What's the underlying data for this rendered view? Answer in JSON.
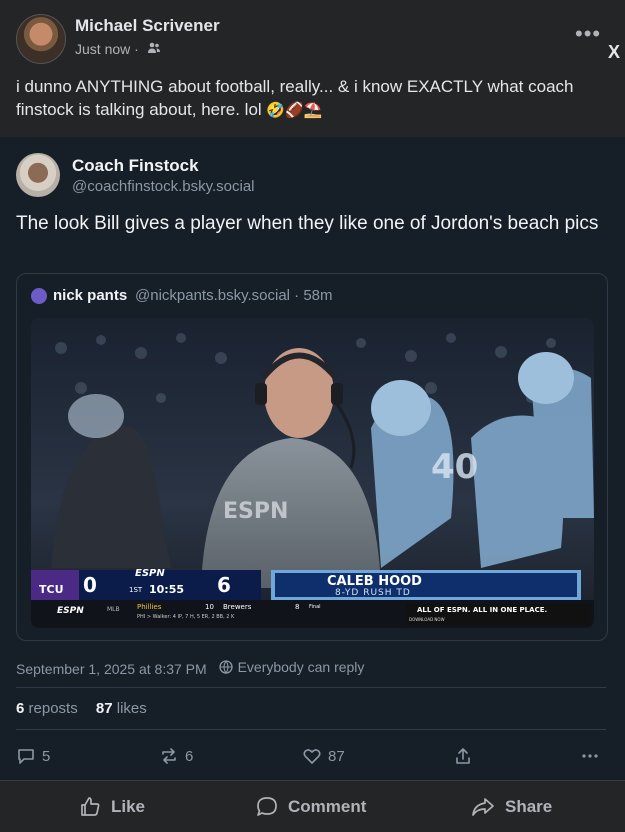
{
  "post": {
    "author": "Michael Scrivener",
    "time": "Just now · ",
    "text": "i dunno ANYTHING about football, really... & i know EXACTLY what coach finstock is talking about, here. lol",
    "emojis": "🤣🏈⛱️",
    "close_label": "X",
    "more_label": "•••"
  },
  "embed": {
    "name": "Coach Finstock",
    "handle": "@coachfinstock.bsky.social",
    "text": "The look Bill gives a player when they like one of Jordon's beach pics",
    "quote": {
      "name": "nick pants",
      "meta": "@nickpants.bsky.social · 58m"
    },
    "scoreboard": {
      "network": "ESPN",
      "team_left": "TCU",
      "score_left": "0",
      "quarter": "1ST",
      "clock": "10:55",
      "score_right": "6",
      "player_name": "CALEB HOOD",
      "play": "8-YD RUSH TD",
      "ticker_league": "MLB",
      "ticker_team1": "Phillies",
      "ticker_score1": "10",
      "ticker_team2": "Brewers",
      "ticker_score2": "8",
      "ticker_status": "Final",
      "ticker_detail": "PHI > Walker: 4 IP, 7 H, 5 ER, 2 BB, 2 K",
      "promo_text": "ALL OF ESPN. ALL IN ONE PLACE.",
      "promo_sub": "DOWNLOAD NOW"
    },
    "date": "September 1, 2025 at 8:37 PM",
    "reply_setting": "Everybody can reply",
    "reposts_count": "6",
    "reposts_label": "reposts",
    "likes_count": "87",
    "likes_label": "likes",
    "reply_count": "5",
    "repost_count": "6",
    "like_count": "87"
  },
  "actions": {
    "like": "Like",
    "comment": "Comment",
    "share": "Share"
  }
}
